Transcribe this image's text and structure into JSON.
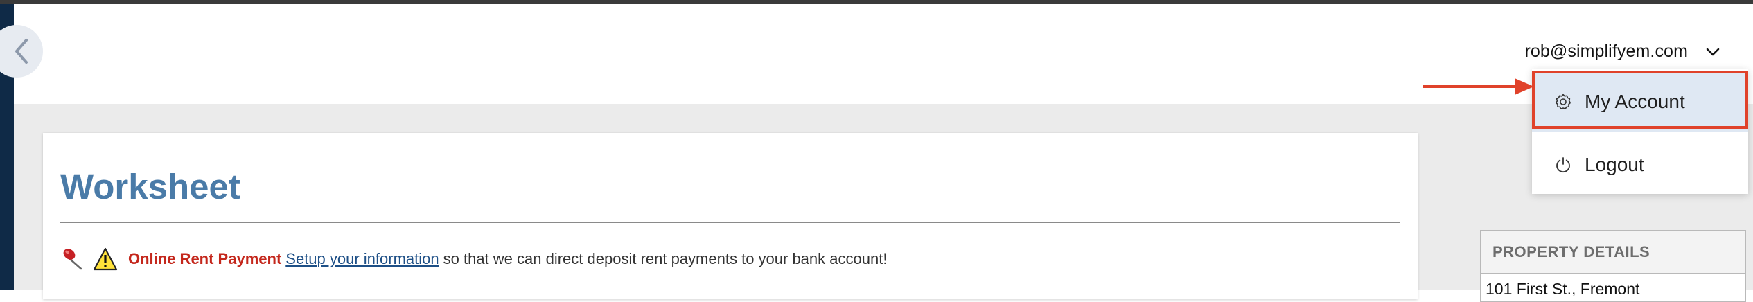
{
  "header": {
    "user_email": "rob@simplifyem.com",
    "back_icon": "chevron-left-icon",
    "menu_toggle_icon": "chevron-down-icon"
  },
  "user_dropdown": {
    "items": [
      {
        "label": "My Account",
        "icon": "gear-icon",
        "highlighted": true
      },
      {
        "label": "Logout",
        "icon": "power-icon"
      }
    ]
  },
  "main": {
    "title": "Worksheet",
    "notice": {
      "title": "Online Rent Payment",
      "link_text": "Setup your information",
      "text": "so that we can direct deposit rent payments to your bank account!",
      "icons": [
        "pushpin-icon",
        "warning-icon"
      ]
    }
  },
  "property_details": {
    "heading": "PROPERTY DETAILS",
    "address": "101 First St., Fremont"
  },
  "colors": {
    "title_blue": "#4a7ba8",
    "alert_red": "#c4271c",
    "link_blue": "#1d4f86",
    "annotation_red": "#e0422a",
    "menu_highlight": "#dfe8f3",
    "sidebar_navy": "#0f2a47"
  }
}
